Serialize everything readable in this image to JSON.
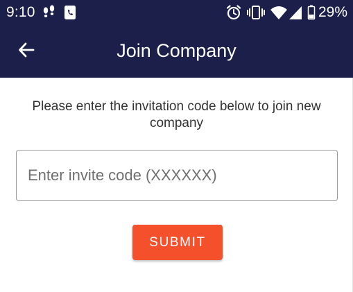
{
  "status_bar": {
    "time": "9:10",
    "battery_percent": "29%",
    "icons": [
      "footsteps-icon",
      "phone-app-icon",
      "alarm-icon",
      "vibrate-icon",
      "wifi-icon",
      "signal-icon",
      "battery-icon"
    ]
  },
  "app_bar": {
    "title": "Join Company",
    "back_icon": "arrow-left-icon"
  },
  "form": {
    "instructions": "Please enter the invitation code below to join new company",
    "invite_placeholder": "Enter invite code (XXXXXX)",
    "invite_value": "",
    "submit_label": "SUBMIT"
  },
  "colors": {
    "header": "#1b1f4a",
    "accent": "#f4502b"
  }
}
